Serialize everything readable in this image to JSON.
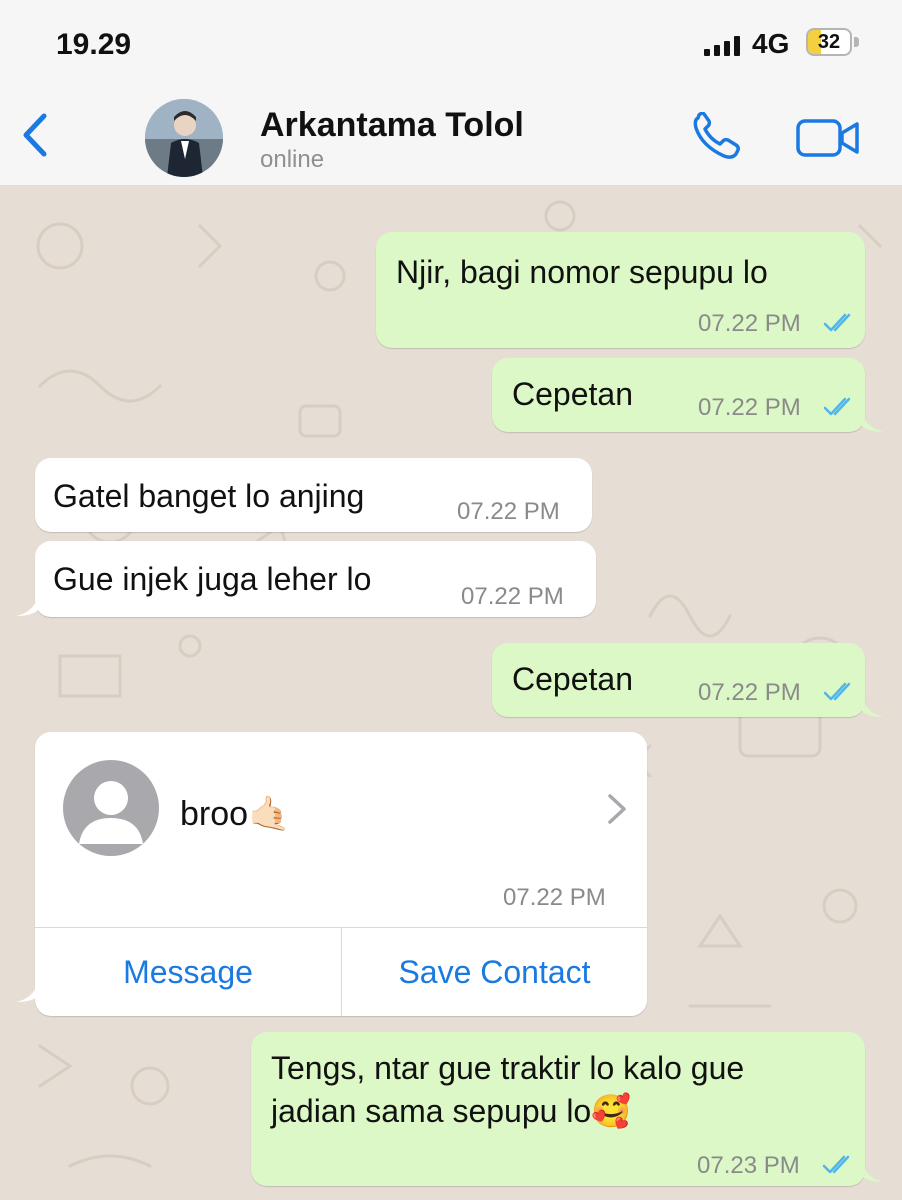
{
  "status_bar": {
    "time": "19.29",
    "network": "4G",
    "battery": "32",
    "battery_level": 0.32
  },
  "header": {
    "contact_name": "Arkantama Tolol",
    "contact_status": "online"
  },
  "colors": {
    "accent": "#1a7ae2",
    "outgoing_bubble": "#dcf8c6",
    "incoming_bubble": "#ffffff",
    "read_ticks": "#4fb6ec"
  },
  "messages": [
    {
      "direction": "out",
      "text": "Njir, bagi nomor sepupu lo",
      "time": "07.22 PM",
      "status": "read"
    },
    {
      "direction": "out",
      "text": "Cepetan",
      "time": "07.22 PM",
      "status": "read"
    },
    {
      "direction": "in",
      "text": "Gatel banget lo anjing",
      "time": "07.22 PM"
    },
    {
      "direction": "in",
      "text": "Gue injek juga leher lo",
      "time": "07.22 PM"
    },
    {
      "direction": "out",
      "text": "Cepetan",
      "time": "07.22 PM",
      "status": "read"
    },
    {
      "direction": "out",
      "text_line1": "Tengs, ntar gue traktir lo kalo gue",
      "text_line2": "jadian sama sepupu lo🥰",
      "time": "07.23 PM",
      "status": "read"
    }
  ],
  "contact_card": {
    "name": "broo🤙🏻",
    "time": "07.22 PM",
    "message_button": "Message",
    "save_button": "Save Contact"
  }
}
